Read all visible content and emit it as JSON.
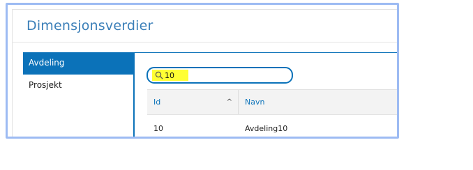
{
  "panel": {
    "title": "Dimensjonsverdier"
  },
  "sidebar": {
    "items": [
      {
        "label": "Avdeling",
        "active": true
      },
      {
        "label": "Prosjekt",
        "active": false
      }
    ]
  },
  "search": {
    "value": "10",
    "icon": "search-icon",
    "highlight_color": "#ffff33"
  },
  "table": {
    "columns": [
      {
        "label": "Id",
        "sort": "ascending"
      },
      {
        "label": "Navn"
      }
    ],
    "rows": [
      {
        "id": "10",
        "navn": "Avdeling10"
      }
    ]
  },
  "colors": {
    "accent": "#0b72b9",
    "title": "#3b7fb8",
    "frame_border": "#9dbbf3"
  }
}
